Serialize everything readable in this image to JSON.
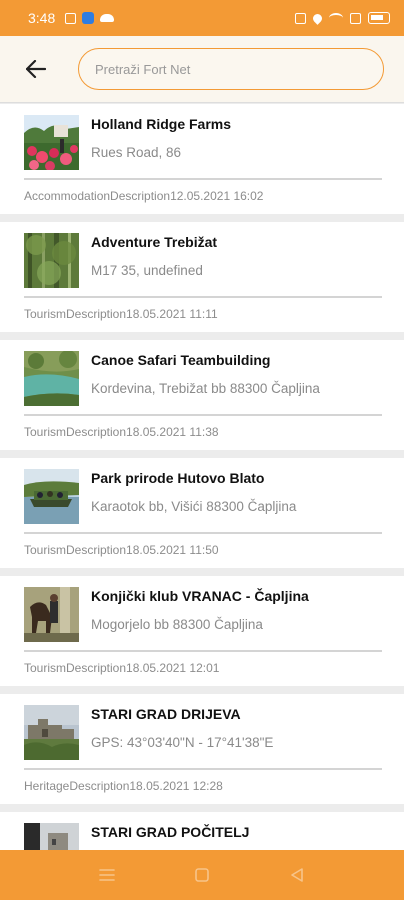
{
  "status_bar": {
    "time": "3:48"
  },
  "header": {
    "search_placeholder": "Pretraži Fort Net"
  },
  "items": [
    {
      "title": "Holland Ridge Farms",
      "address": "Rues Road, 86",
      "meta": "AccommodationDescription12.05.2021 16:02",
      "thumb": "tulip-field"
    },
    {
      "title": "Adventure Trebižat",
      "address": "M17 35, undefined",
      "meta": "TourismDescription18.05.2021 11:11",
      "thumb": "forest"
    },
    {
      "title": "Canoe Safari Teambuilding",
      "address": "Kordevina, Trebižat bb 88300 Čapljina",
      "meta": "TourismDescription18.05.2021 11:38",
      "thumb": "river"
    },
    {
      "title": "Park prirode Hutovo Blato",
      "address": "Karaotok bb, Višići 88300 Čapljina",
      "meta": "TourismDescription18.05.2021 11:50",
      "thumb": "boat-lake"
    },
    {
      "title": "Konjički klub VRANAC - Čapljina",
      "address": "Mogorjelo bb 88300 Čapljina",
      "meta": "TourismDescription18.05.2021 12:01",
      "thumb": "horse"
    },
    {
      "title": "STARI GRAD DRIJEVA",
      "address": "GPS: 43°03'40\"N - 17°41'38\"E",
      "meta": "HeritageDescription18.05.2021 12:28",
      "thumb": "ruins"
    },
    {
      "title": "STARI GRAD POČITELJ",
      "address": "",
      "meta": "",
      "thumb": "old-town"
    }
  ],
  "colors": {
    "accent": "#f39a35",
    "header_bg": "#faf6ee"
  }
}
